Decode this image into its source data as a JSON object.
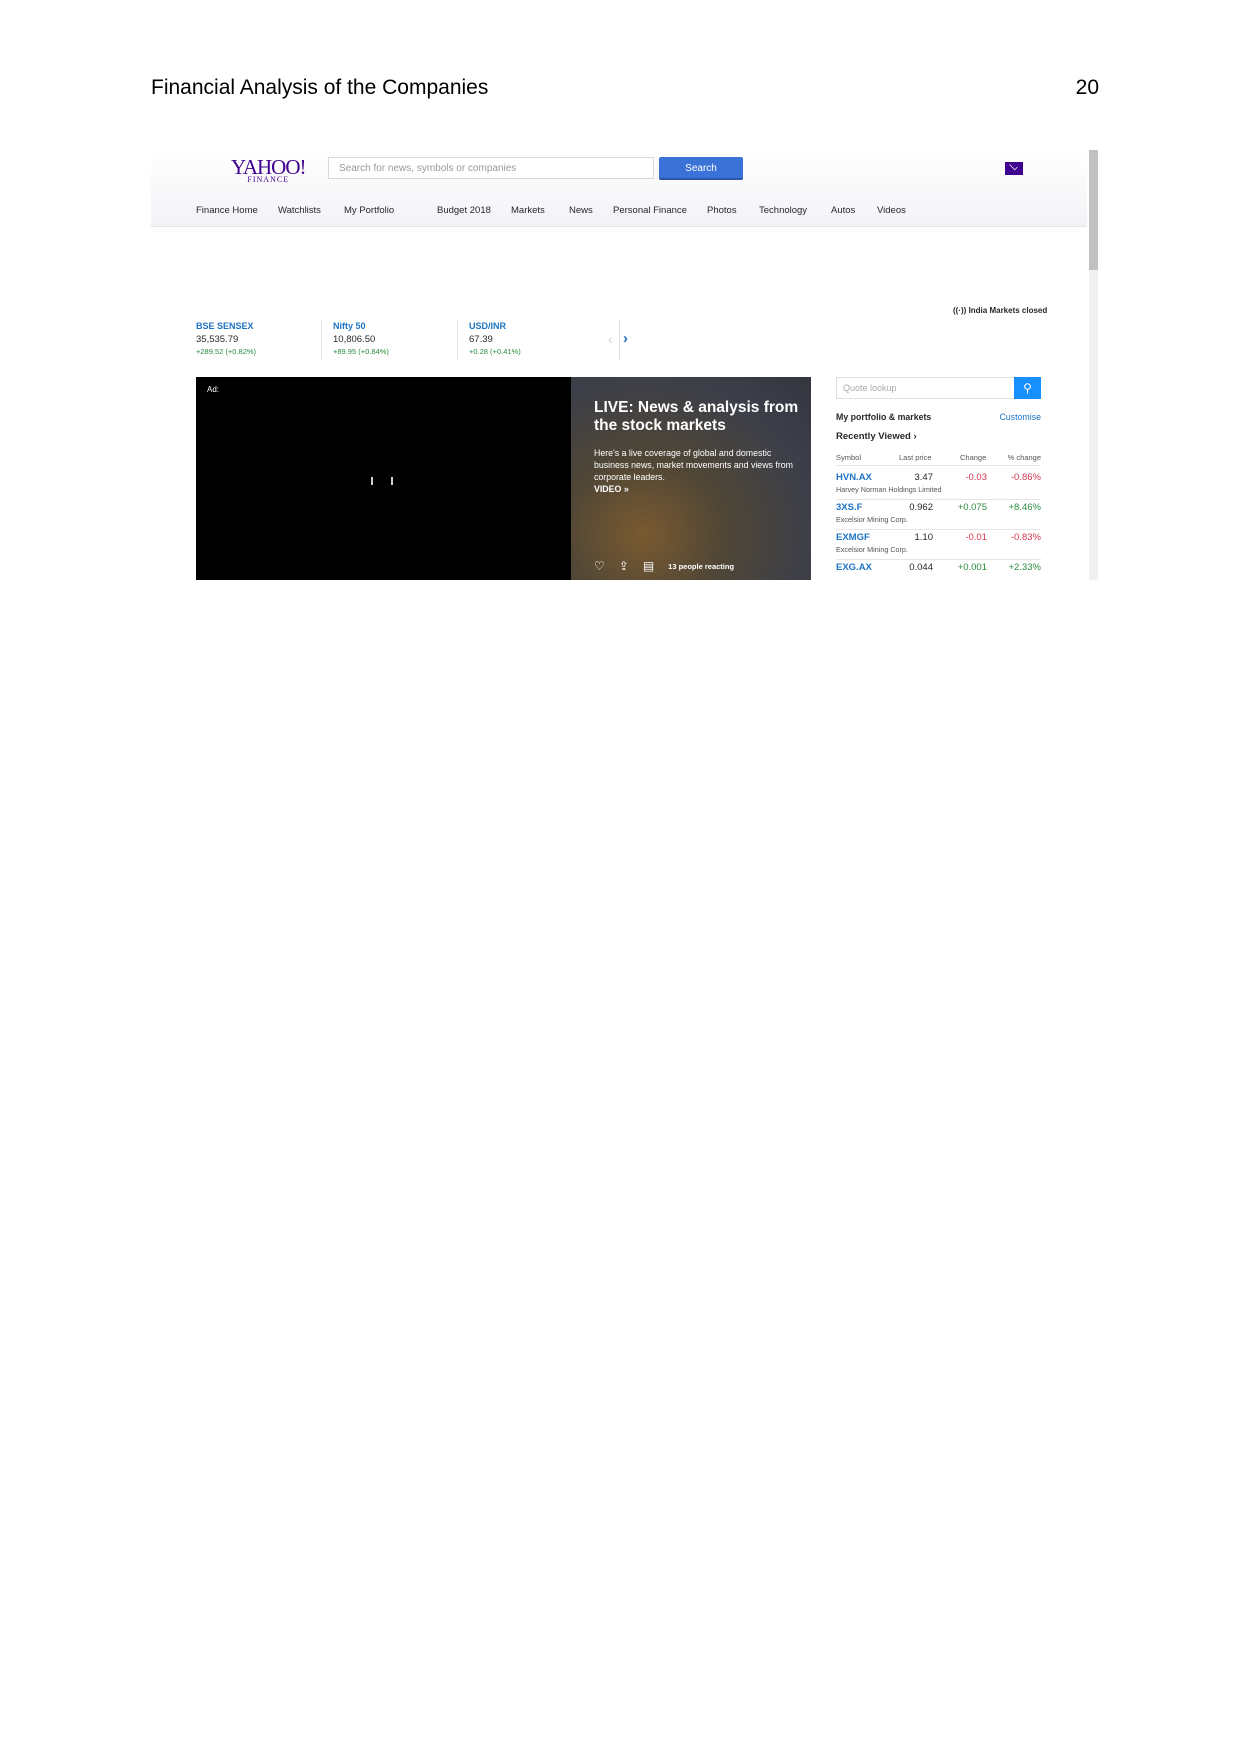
{
  "document": {
    "header_title": "Financial Analysis of the Companies",
    "page_number": "20"
  },
  "browser": {
    "logo": {
      "main": "YAHOO!",
      "sub": "FINANCE"
    },
    "search": {
      "placeholder": "Search for news, symbols or companies",
      "button_label": "Search"
    },
    "mail_icon": "envelope-icon",
    "nav": [
      "Finance Home",
      "Watchlists",
      "My Portfolio",
      "Budget 2018",
      "Markets",
      "News",
      "Personal Finance",
      "Photos",
      "Technology",
      "Autos",
      "Videos"
    ],
    "market_status": "India Markets closed",
    "tickers": [
      {
        "name": "BSE SENSEX",
        "value": "35,535.79",
        "change": "+289.52 (+0.82%)"
      },
      {
        "name": "Nifty 50",
        "value": "10,806.50",
        "change": "+89.95 (+0.84%)"
      },
      {
        "name": "USD/INR",
        "value": "67.39",
        "change": "+0.28 (+0.41%)"
      }
    ],
    "ad_label": "Ad:",
    "hero": {
      "title": "LIVE: News & analysis from the stock markets",
      "description": "Here's a live coverage of global and domestic business news, market movements and views from corporate leaders.",
      "video_link": "VIDEO »",
      "reactions": "13 people reacting"
    },
    "rail": {
      "quote_placeholder": "Quote lookup",
      "portfolio_title": "My portfolio & markets",
      "customise": "Customise",
      "recently_viewed": "Recently Viewed ›",
      "columns": [
        "Symbol",
        "Last price",
        "Change",
        "% change"
      ],
      "rows": [
        {
          "symbol": "HVN.AX",
          "company": "Harvey Norman Holdings Limited",
          "price": "3.47",
          "change": "-0.03",
          "pct": "-0.86%",
          "dir": "neg"
        },
        {
          "symbol": "3XS.F",
          "company": "Excelsior Mining Corp.",
          "price": "0.962",
          "change": "+0.075",
          "pct": "+8.46%",
          "dir": "pos"
        },
        {
          "symbol": "EXMGF",
          "company": "Excelsior Mining Corp.",
          "price": "1.10",
          "change": "-0.01",
          "pct": "-0.83%",
          "dir": "neg"
        },
        {
          "symbol": "EXG.AX",
          "company": "",
          "price": "0.044",
          "change": "+0.001",
          "pct": "+2.33%",
          "dir": "pos"
        }
      ]
    }
  }
}
